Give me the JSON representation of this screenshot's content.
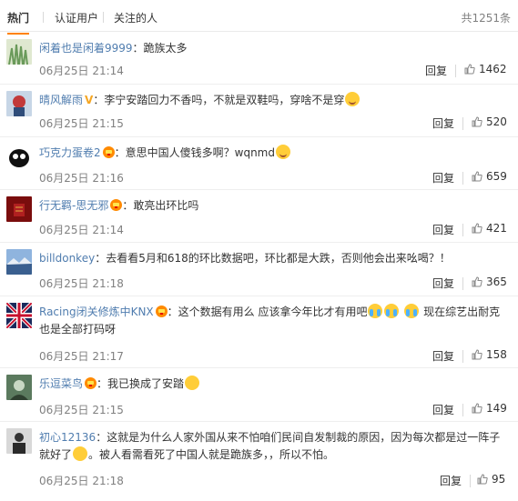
{
  "tabs": {
    "items": [
      "热门",
      "认证用户",
      "关注的人"
    ],
    "active": 0,
    "total": "共1251条"
  },
  "reply_label": "回复",
  "comments": [
    {
      "user": "闲着也是闲着9999",
      "text": "：跪族太多",
      "time": "06月25日 21:14",
      "likes": "1462"
    },
    {
      "user": "晴风解雨",
      "text": "：李宁安踏回力不香吗，不就是双鞋吗，穿啥不是穿",
      "time": "06月25日 21:15",
      "likes": "520"
    },
    {
      "user": "巧克力蛋卷2",
      "text": "：意思中国人傻钱多啊？wqnmd",
      "time": "06月25日 21:16",
      "likes": "659"
    },
    {
      "user": "行无羁-思无邪",
      "text": "：敢亮出环比吗",
      "time": "06月25日 21:14",
      "likes": "421"
    },
    {
      "user": "billdonkey",
      "text": "：去看看5月和618的环比数据吧，环比都是大跌，否则他会出来吆喝？！",
      "time": "06月25日 21:18",
      "likes": "365"
    },
    {
      "user": "Racing闭关修炼中KNX",
      "text": "：这个数据有用么 应该拿今年比才有用吧",
      "text2": "现在综艺出耐克也是全部打码呀",
      "time": "06月25日 21:17",
      "likes": "158"
    },
    {
      "user": "乐逗菜鸟",
      "text": "：我已换成了安踏",
      "time": "06月25日 21:15",
      "likes": "149"
    },
    {
      "user": "初心12136",
      "text": "：这就是为什么人家外国从来不怕咱们民间自发制裁的原因，因为每次都是过一阵子就好了",
      "text2": "。被人看需看死了中国人就是跪族多，，所以不怕。",
      "time": "06月25日 21:18",
      "likes": "95"
    }
  ],
  "colors": {
    "accent": "#ff8200",
    "username": "#507daf",
    "muted": "#808080"
  }
}
